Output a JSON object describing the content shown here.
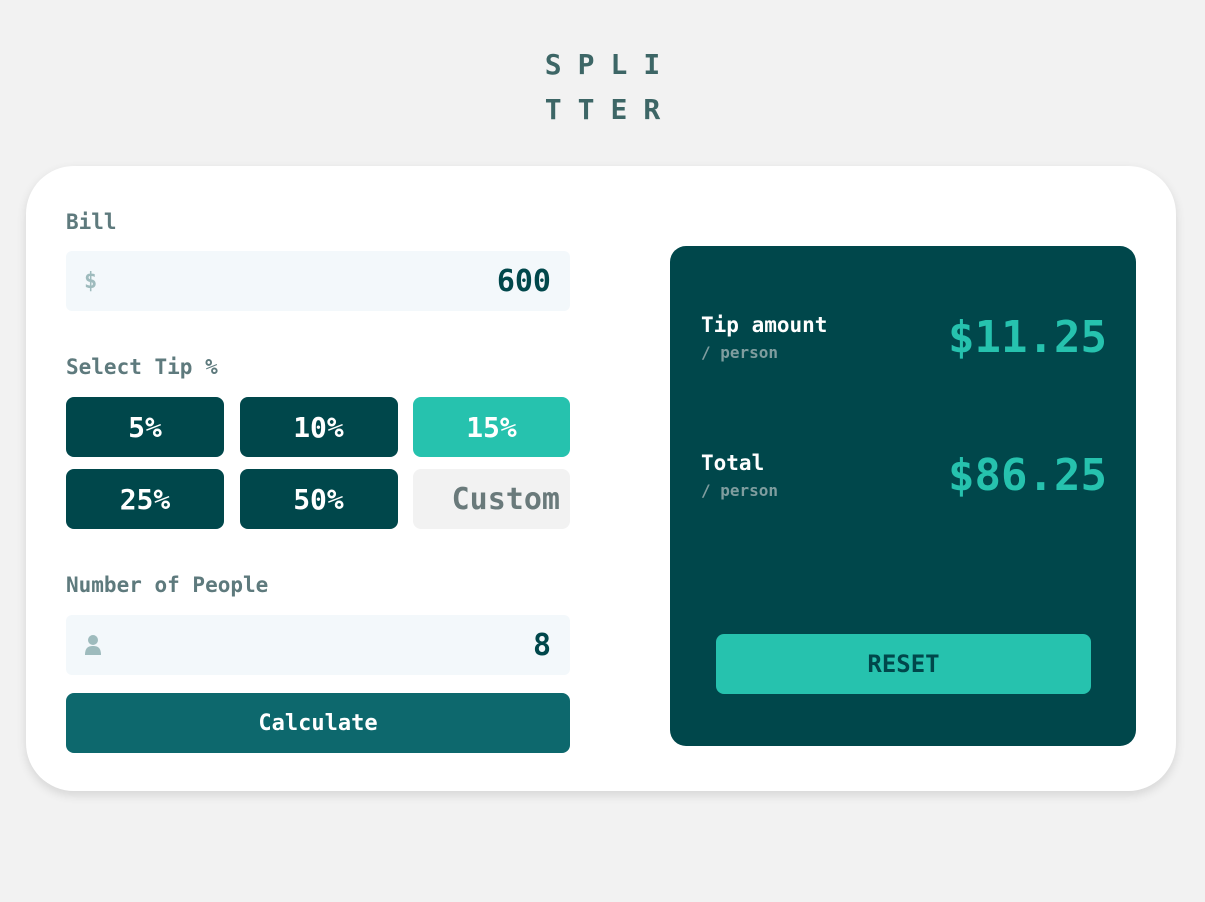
{
  "logo": {
    "line1": "SPLI",
    "line2": "TTER"
  },
  "bill": {
    "label": "Bill",
    "currency_icon": "$",
    "value": "600"
  },
  "tip": {
    "label": "Select Tip %",
    "options": [
      "5%",
      "10%",
      "15%",
      "25%",
      "50%"
    ],
    "selected": "15%",
    "custom_placeholder": "Custom"
  },
  "people": {
    "label": "Number of People",
    "value": "8",
    "icon": "person-icon"
  },
  "calculate_label": "Calculate",
  "results": {
    "tip_title": "Tip amount",
    "tip_sub": "/ person",
    "tip_value": "$11.25",
    "total_title": "Total",
    "total_sub": "/ person",
    "total_value": "$86.25",
    "reset_label": "RESET"
  },
  "colors": {
    "dark_cyan": "#00474b",
    "strong_cyan": "#26c2ae",
    "calculate_teal": "#0d686d",
    "background": "#f2f2f2"
  }
}
